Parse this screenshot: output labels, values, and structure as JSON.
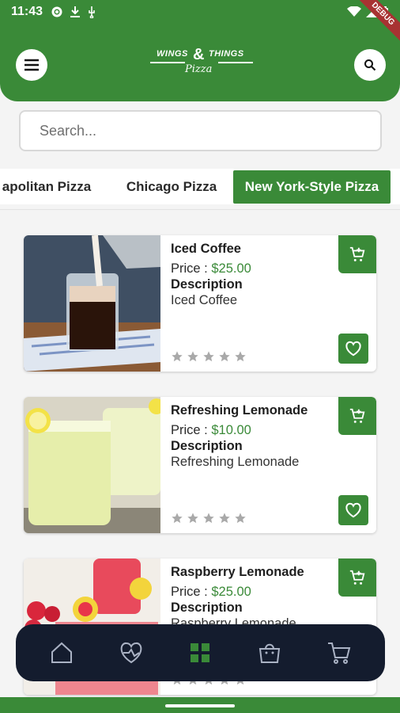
{
  "status_bar": {
    "time": "11:43"
  },
  "header": {
    "logo": {
      "line1": "WINGS",
      "amp": "&",
      "line2": "THINGS",
      "line3": "Pizza"
    },
    "debug_banner": "DEBUG"
  },
  "search": {
    "placeholder": "Search..."
  },
  "categories": [
    "apolitan Pizza",
    "Chicago Pizza",
    "New York-Style Pizza"
  ],
  "active_category": "New York-Style Pizza",
  "products": [
    {
      "name": "Iced Coffee",
      "price_label": "Price : ",
      "price": "$25.00",
      "description_label": "Description",
      "description": "Iced Coffee",
      "rating": 0
    },
    {
      "name": "Refreshing Lemonade",
      "price_label": "Price : ",
      "price": "$10.00",
      "description_label": "Description",
      "description": "Refreshing Lemonade",
      "rating": 0
    },
    {
      "name": "Raspberry Lemonade",
      "price_label": "Price : ",
      "price": "$25.00",
      "description_label": "Description",
      "description": "Raspberry Lemonade",
      "rating": 0
    }
  ],
  "bottom_nav": [
    "home-icon",
    "favorites-icon",
    "categories-icon",
    "bag-icon",
    "cart-icon"
  ],
  "active_nav": "categories-icon",
  "colors": {
    "primary": "#3a8a38",
    "nav_bg": "#141c2e",
    "star": "#a9a9a9"
  }
}
